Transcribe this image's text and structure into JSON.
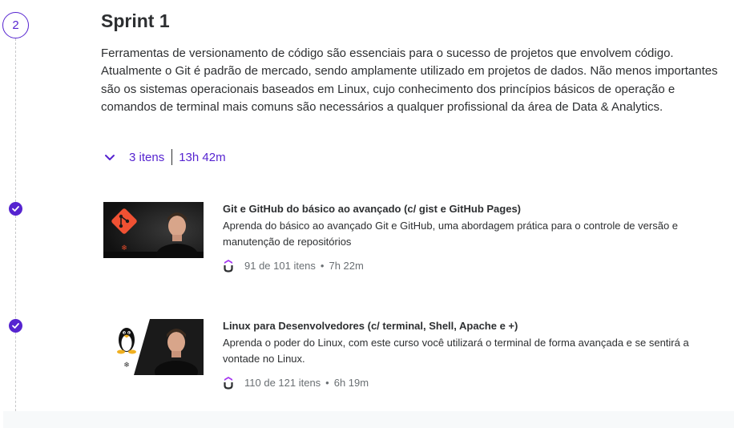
{
  "step": {
    "number": "2"
  },
  "sprint": {
    "title": "Sprint 1",
    "description": "Ferramentas de versionamento de código são essenciais para o sucesso de projetos que envolvem código. Atualmente o Git é padrão de mercado, sendo amplamente utilizado em projetos de dados. Não menos importantes são os sistemas operacionais baseados em Linux, cujo conhecimento dos princípios básicos de operação e comandos de terminal mais comuns são necessários a qualquer profissional da área de Data & Analytics.",
    "items_count": "3 itens",
    "duration": "13h 42m"
  },
  "courses": [
    {
      "title": "Git e GitHub do básico ao avançado (c/ gist e GitHub Pages)",
      "description": "Aprenda do básico ao avançado Git e GitHub, uma abordagem prática para o controle de versão e manutenção de repositórios",
      "progress": "91 de 101 itens",
      "duration": "7h 22m",
      "completed": true,
      "thumbnail_icon": "git-logo-icon"
    },
    {
      "title": "Linux para Desenvolvedores (c/ terminal, Shell, Apache e +)",
      "description": "Aprenda o poder do Linux, com este curso você utilizará o terminal de forma avançada e se sentirá a vontade no Linux.",
      "progress": "110 de 121 itens",
      "duration": "6h 19m",
      "completed": true,
      "thumbnail_icon": "tux-penguin-icon"
    }
  ],
  "colors": {
    "accent": "#5624d0",
    "text": "#2d2f31",
    "muted": "#6a6f73",
    "git_orange": "#f05133"
  },
  "icons": {
    "expand": "chevron-down-icon",
    "provider": "udemy-icon",
    "check": "check-circle-icon"
  }
}
